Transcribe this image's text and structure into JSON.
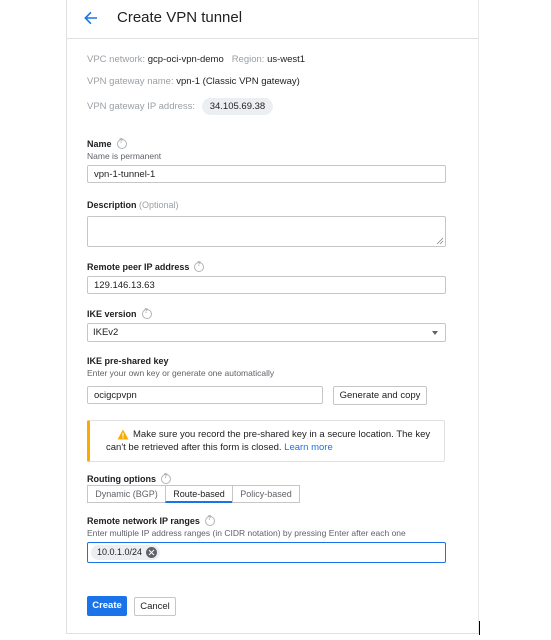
{
  "header": {
    "title": "Create VPN tunnel"
  },
  "info": {
    "vpc_label": "VPC network:",
    "vpc_value": "gcp-oci-vpn-demo",
    "region_label": "Region:",
    "region_value": "us-west1",
    "gateway_label": "VPN gateway name:",
    "gateway_value": "vpn-1 (Classic VPN gateway)",
    "ip_label": "VPN gateway IP address:",
    "ip_value": "34.105.69.38"
  },
  "name": {
    "label": "Name",
    "sub": "Name is permanent",
    "value": "vpn-1-tunnel-1"
  },
  "description": {
    "label": "Description",
    "optional": "(Optional)",
    "value": ""
  },
  "remote_peer": {
    "label": "Remote peer IP address",
    "value": "129.146.13.63"
  },
  "ike_version": {
    "label": "IKE version",
    "value": "IKEv2"
  },
  "ike_key": {
    "label": "IKE pre-shared key",
    "sub": "Enter your own key or generate one automatically",
    "value": "ocigcpvpn",
    "generate_label": "Generate and copy"
  },
  "warning": {
    "text1": "Make sure you record the pre-shared key in a secure location. The key",
    "text2": "can't be retrieved after this form is closed.",
    "link": "Learn more"
  },
  "routing": {
    "label": "Routing options",
    "options": [
      "Dynamic (BGP)",
      "Route-based",
      "Policy-based"
    ],
    "selected": "Route-based"
  },
  "remote_ranges": {
    "label": "Remote network IP ranges",
    "sub": "Enter multiple IP address ranges (in CIDR notation) by pressing Enter after each one",
    "chips": [
      "10.0.1.0/24"
    ]
  },
  "actions": {
    "create": "Create",
    "cancel": "Cancel"
  },
  "colors": {
    "accent": "#1a73e8",
    "warning": "#f9ab00"
  },
  "icons": {
    "back": "arrow-left-icon",
    "help": "help-circle-icon",
    "warning": "warning-triangle-icon",
    "chip_remove": "close-circle-icon",
    "dropdown": "caret-down-icon"
  }
}
